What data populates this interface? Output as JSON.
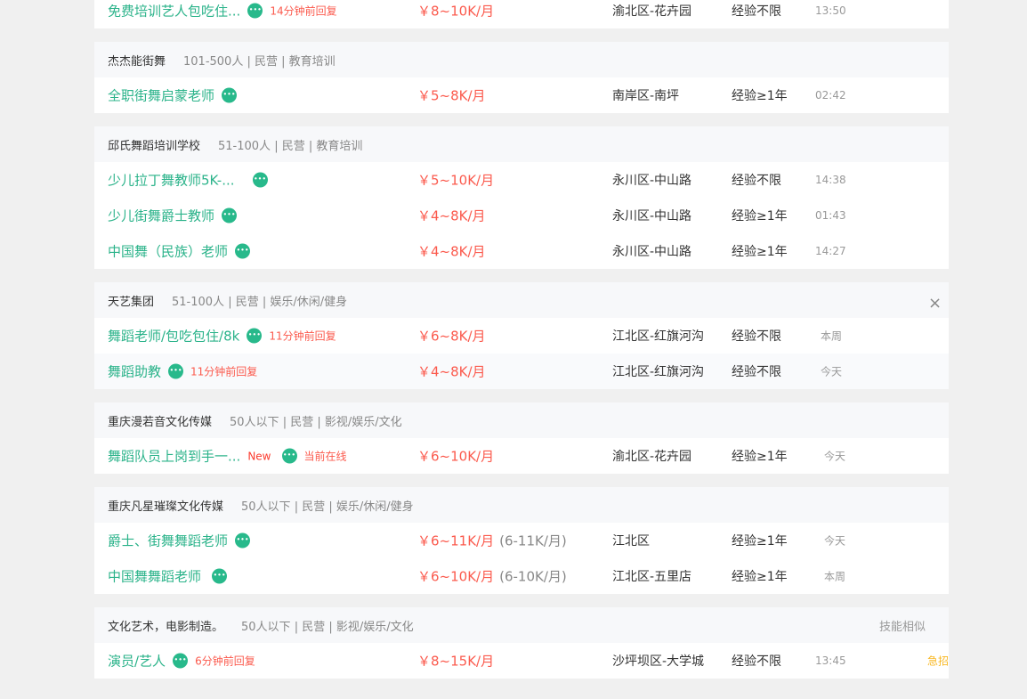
{
  "groups": [
    {
      "company": "",
      "meta": "",
      "jobs": [
        {
          "title": "免费培训艺人包吃住...",
          "reply": "14分钟前回复",
          "salary": "￥8~10K/月",
          "paren": "",
          "loc": "渝北区-花卉园",
          "exp": "经验不限",
          "time": "13:50"
        }
      ]
    },
    {
      "company": "杰杰能街舞",
      "meta": "101-500人 | 民营 | 教育培训",
      "jobs": [
        {
          "title": "全职街舞启蒙老师",
          "reply": "",
          "salary": "￥5~8K/月",
          "paren": "",
          "loc": "南岸区-南坪",
          "exp": "经验≥1年",
          "time": "02:42"
        }
      ]
    },
    {
      "company": "邱氏舞蹈培训学校",
      "meta": "51-100人 | 民营 | 教育培训",
      "jobs": [
        {
          "title": "少儿拉丁舞教师5K-...",
          "reply": "",
          "salary": "￥5~10K/月",
          "paren": "",
          "loc": "永川区-中山路",
          "exp": "经验不限",
          "time": "14:38"
        },
        {
          "title": "少儿街舞爵士教师",
          "reply": "",
          "salary": "￥4~8K/月",
          "paren": "",
          "loc": "永川区-中山路",
          "exp": "经验≥1年",
          "time": "01:43"
        },
        {
          "title": "中国舞（民族）老师",
          "reply": "",
          "salary": "￥4~8K/月",
          "paren": "",
          "loc": "永川区-中山路",
          "exp": "经验≥1年",
          "time": "14:27"
        }
      ]
    },
    {
      "company": "天艺集团",
      "meta": "51-100人 | 民营 | 娱乐/休闲/健身",
      "jobs": [
        {
          "title": "舞蹈老师/包吃包住/8k",
          "reply": "11分钟前回复",
          "salary": "￥6~8K/月",
          "paren": "",
          "loc": "江北区-红旗河沟",
          "exp": "经验不限",
          "time": "本周"
        },
        {
          "title": "舞蹈助教",
          "reply": "11分钟前回复",
          "salary": "￥4~8K/月",
          "paren": "",
          "loc": "江北区-红旗河沟",
          "exp": "经验不限",
          "time": "今天"
        }
      ]
    },
    {
      "company": "重庆漫若音文化传媒",
      "meta": "50人以下 | 民营 | 影视/娱乐/文化",
      "jobs": [
        {
          "title": "舞蹈队员上岗到手一...",
          "isNew": "New",
          "reply": "当前在线",
          "salary": "￥6~10K/月",
          "paren": "",
          "loc": "渝北区-花卉园",
          "exp": "经验≥1年",
          "time": "今天"
        }
      ]
    },
    {
      "company": "重庆凡星璀璨文化传媒",
      "meta": "50人以下 | 民营 | 娱乐/休闲/健身",
      "jobs": [
        {
          "title": "爵士、街舞舞蹈老师",
          "reply": "",
          "salary": "￥6~11K/月",
          "paren": "(6-11K/月)",
          "loc": "江北区",
          "exp": "经验≥1年",
          "time": "今天"
        },
        {
          "title": "中国舞舞蹈老师",
          "reply": "",
          "salary": "￥6~10K/月",
          "paren": "(6-10K/月)",
          "loc": "江北区-五里店",
          "exp": "经验≥1年",
          "time": "本周"
        }
      ]
    },
    {
      "company": "文化艺术，电影制造。",
      "meta": "50人以下 | 民营 | 影视/娱乐/文化",
      "similar": "技能相似",
      "jobs": [
        {
          "title": "演员/艺人",
          "reply": "6分钟前回复",
          "salary": "￥8~15K/月",
          "paren": "",
          "loc": "沙坪坝区-大学城",
          "exp": "经验不限",
          "time": "13:45",
          "urgent": "急招"
        }
      ]
    }
  ],
  "close_icon": "×"
}
